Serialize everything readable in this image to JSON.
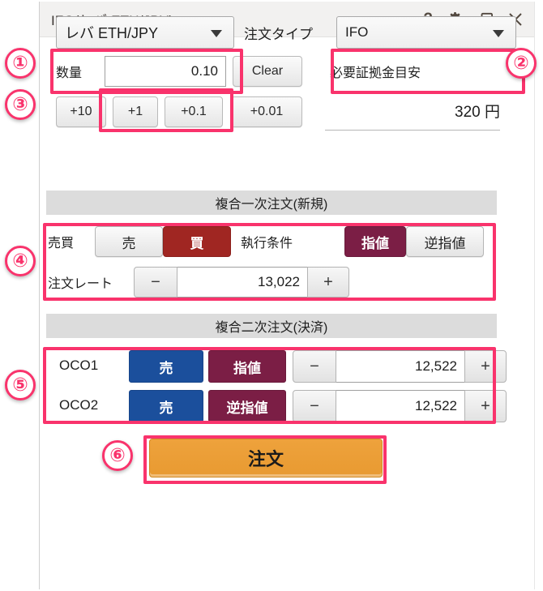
{
  "window": {
    "title": "IFO(レバ ETH/JPY)",
    "icons": [
      {
        "name": "help-icon",
        "glyph": "?"
      },
      {
        "name": "gear-icon",
        "glyph": "gear"
      },
      {
        "name": "restore-icon",
        "glyph": "restore"
      },
      {
        "name": "close-icon",
        "glyph": "×"
      }
    ]
  },
  "markers": [
    "①",
    "②",
    "③",
    "④",
    "⑤",
    "⑥"
  ],
  "pair_select": {
    "value": "レバ ETH/JPY"
  },
  "order_type": {
    "label": "注文タイプ",
    "value": "IFO"
  },
  "quantity": {
    "label": "数量",
    "value": "0.10",
    "clear_label": "Clear",
    "steps": [
      "+10",
      "+1",
      "+0.1",
      "+0.01"
    ]
  },
  "margin": {
    "label": "必要証拠金目安",
    "value": "320 円"
  },
  "primary": {
    "header": "複合一次注文(新規)",
    "side_label": "売買",
    "side_sell": "売",
    "side_buy": "買",
    "cond_label": "執行条件",
    "cond_limit": "指値",
    "cond_stop": "逆指値",
    "rate_label": "注文レート",
    "rate_minus": "−",
    "rate_value": "13,022",
    "rate_plus": "+"
  },
  "secondary": {
    "header": "複合二次注文(決済)",
    "rows": [
      {
        "name": "OCO1",
        "side": "売",
        "cond": "指値",
        "minus": "−",
        "value": "12,522",
        "plus": "+"
      },
      {
        "name": "OCO2",
        "side": "売",
        "cond": "逆指値",
        "minus": "−",
        "value": "12,522",
        "plus": "+"
      }
    ]
  },
  "submit": {
    "label": "注文"
  },
  "colors": {
    "highlight": "#f9336c",
    "buy": "#a02622",
    "limit": "#7b1e45",
    "sell": "#1b4f9c",
    "submit": "#eea23c",
    "header_bar": "#dcdcdc"
  }
}
